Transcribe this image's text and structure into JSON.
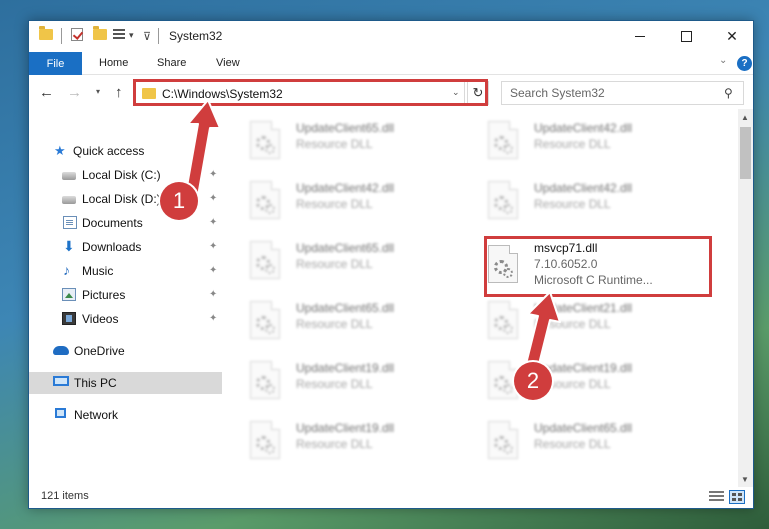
{
  "window": {
    "title": "System32",
    "quick_access_caret": "▾",
    "close_glyph": "✕"
  },
  "ribbon": {
    "tabs": [
      "File",
      "Home",
      "Share",
      "View"
    ],
    "expand_glyph": "⌄",
    "help_glyph": "?"
  },
  "navbar": {
    "back_glyph": "←",
    "forward_glyph": "→",
    "recent_glyph": "▾",
    "up_glyph": "↑",
    "address": "C:\\Windows\\System32",
    "address_dropdown_glyph": "⌄",
    "refresh_glyph": "↻",
    "search_placeholder": "Search System32",
    "search_glyph": "⚲"
  },
  "nav_pane": {
    "pin_glyph": "📌",
    "items": [
      {
        "label": "Quick access",
        "icon": "star-icon"
      },
      {
        "label": "Local Disk (C:)",
        "icon": "disk-icon",
        "pinned": true
      },
      {
        "label": "Local Disk (D:)",
        "icon": "disk-icon",
        "pinned": true
      },
      {
        "label": "Documents",
        "icon": "documents-icon",
        "pinned": true
      },
      {
        "label": "Downloads",
        "icon": "download-icon",
        "pinned": true
      },
      {
        "label": "Music",
        "icon": "music-icon",
        "pinned": true
      },
      {
        "label": "Pictures",
        "icon": "pictures-icon",
        "pinned": true
      },
      {
        "label": "Videos",
        "icon": "videos-icon",
        "pinned": true
      },
      {
        "label": "OneDrive",
        "icon": "onedrive-icon"
      },
      {
        "label": "This PC",
        "icon": "pc-icon",
        "selected": true
      },
      {
        "label": "Network",
        "icon": "network-icon"
      }
    ]
  },
  "files": [
    {
      "name": "UpdateClient65.dll",
      "type": "Resource DLL"
    },
    {
      "name": "UpdateClient42.dll",
      "type": "Resource DLL"
    },
    {
      "name": "UpdateClient42.dll",
      "type": "Resource DLL"
    },
    {
      "name": "UpdateClient42.dll",
      "type": "Resource DLL"
    },
    {
      "name": "UpdateClient65.dll",
      "type": "Resource DLL"
    },
    {
      "name": "msvcp71.dll",
      "version": "7.10.6052.0",
      "type": "Microsoft C Runtime...",
      "highlighted": true
    },
    {
      "name": "UpdateClient65.dll",
      "type": "Resource DLL"
    },
    {
      "name": "UpdateClient21.dll",
      "type": "Resource DLL"
    },
    {
      "name": "UpdateClient19.dll",
      "type": "Resource DLL"
    },
    {
      "name": "UpdateClient19.dll",
      "type": "Resource DLL"
    },
    {
      "name": "UpdateClient19.dll",
      "type": "Resource DLL"
    },
    {
      "name": "UpdateClient65.dll",
      "type": "Resource DLL"
    }
  ],
  "scrollbar": {
    "up_glyph": "▲",
    "down_glyph": "▼"
  },
  "status": {
    "item_count": "121 items"
  },
  "annotations": {
    "step1": "1",
    "step2": "2",
    "highlight_color": "#d03d3d"
  }
}
